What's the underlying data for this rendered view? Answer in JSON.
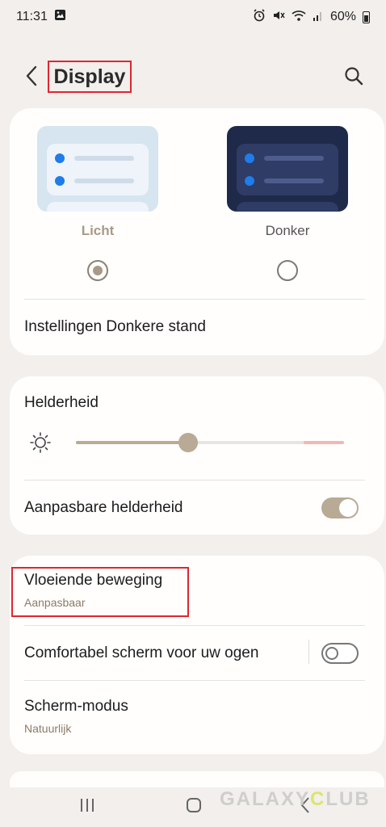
{
  "status": {
    "time": "11:31",
    "battery": "60%",
    "left_icons": [
      "image-icon"
    ],
    "right_icons": [
      "alarm-icon",
      "mute-icon",
      "wifi-icon",
      "signal-icon",
      "battery-icon"
    ]
  },
  "header": {
    "title": "Display"
  },
  "theme": {
    "light_label": "Licht",
    "dark_label": "Donker",
    "selected": "Licht",
    "settings_label": "Instellingen Donkere stand"
  },
  "brightness": {
    "title": "Helderheid",
    "level": 0.42,
    "adaptive_label": "Aanpasbare helderheid",
    "adaptive_on": true
  },
  "motion": {
    "title": "Vloeiende beweging",
    "sub": "Aanpasbaar"
  },
  "eye_comfort": {
    "title": "Comfortabel scherm voor uw ogen",
    "on": false
  },
  "screen_mode": {
    "title": "Scherm-modus",
    "sub": "Natuurlijk"
  },
  "watermark": "GALAXY",
  "watermark_tail": "LUB",
  "colors": {
    "accent": "#b8aa94",
    "highlight_box": "#e0262f",
    "background": "#f2efec"
  }
}
